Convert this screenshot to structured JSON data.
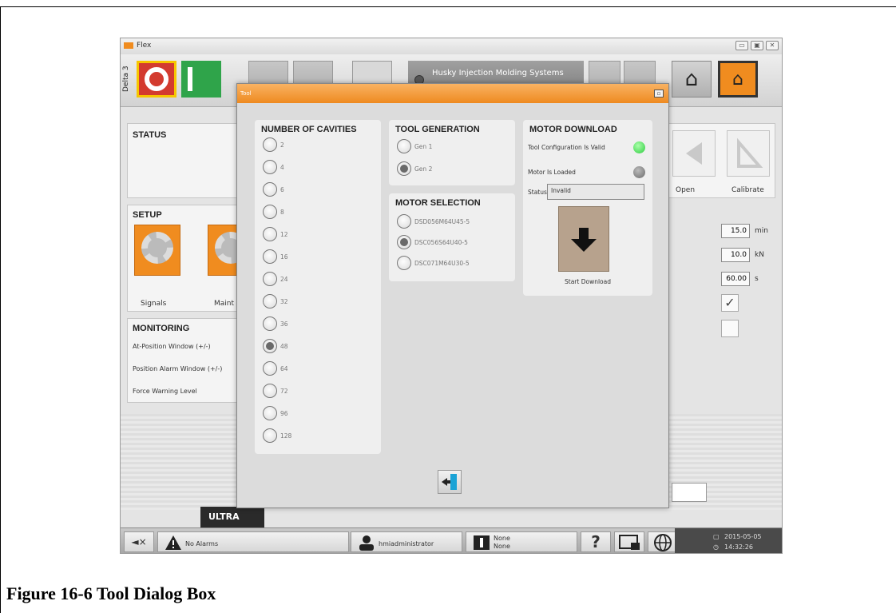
{
  "window": {
    "title": "Flex",
    "buttons": [
      "▭",
      "▣",
      "✕"
    ]
  },
  "toolbar": {
    "machine_label": "Delta 3",
    "husky_text": "Husky Injection Molding Systems"
  },
  "status_panel": {
    "title": "STATUS"
  },
  "setup_panel": {
    "title": "SETUP",
    "tiles": [
      "Signals",
      "Maint"
    ]
  },
  "monitoring_panel": {
    "title": "MONITORING",
    "rows": [
      "At-Position Window (+/-)",
      "Position Alarm Window (+/-)",
      "Force Warning Level"
    ]
  },
  "right_panel": {
    "open_label": "Open",
    "calibrate_label": "Calibrate"
  },
  "params": [
    {
      "value": "15.0",
      "unit": "min"
    },
    {
      "value": "10.0",
      "unit": "kN"
    },
    {
      "value": "60.00",
      "unit": "s"
    }
  ],
  "checkboxes": [
    true,
    false
  ],
  "ultra_label": "ULTRA",
  "bottombar": {
    "alarms": "No Alarms",
    "user": "hmiadministrator",
    "none1": "None",
    "none2": "None",
    "date": "2015-05-05",
    "time": "14:32:26"
  },
  "dialog": {
    "title": "Tool",
    "cavities": {
      "title": "NUMBER OF CAVITIES",
      "options": [
        "2",
        "4",
        "6",
        "8",
        "12",
        "16",
        "24",
        "32",
        "36",
        "48",
        "64",
        "72",
        "96",
        "128"
      ],
      "selected": "48"
    },
    "generation": {
      "title": "TOOL GENERATION",
      "options": [
        "Gen 1",
        "Gen 2"
      ],
      "selected": "Gen 2"
    },
    "motor_selection": {
      "title": "MOTOR SELECTION",
      "options": [
        "DSD056M64U45-5",
        "DSC056S64U40-5",
        "DSC071M64U30-5"
      ],
      "selected": "DSC056S64U40-5"
    },
    "motor_download": {
      "title": "MOTOR DOWNLOAD",
      "config_valid_label": "Tool Configuration Is Valid",
      "config_valid_color": "#2ecc40",
      "motor_loaded_label": "Motor Is Loaded",
      "motor_loaded_color": "#6b6b6b",
      "status_label": "Status",
      "status_value": "Invalid",
      "download_label": "Start Download"
    }
  },
  "caption": "Figure 16-6   Tool Dialog Box"
}
